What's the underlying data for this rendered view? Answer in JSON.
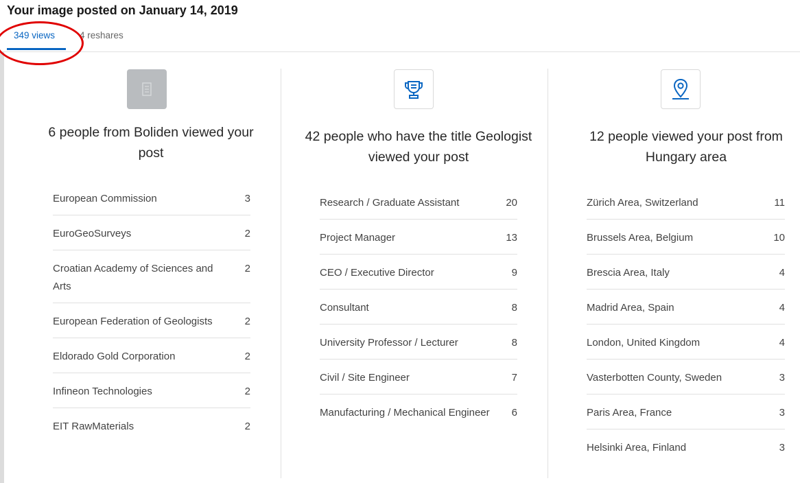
{
  "header": {
    "title": "Your image posted on January 14, 2019"
  },
  "tabs": [
    {
      "label": "349 views",
      "active": true
    },
    {
      "label": "4 reshares",
      "active": false
    }
  ],
  "colors": {
    "accent": "#0a66c2",
    "annotation": "#e00000"
  },
  "columns": [
    {
      "icon": "building-icon",
      "heading": "6 people from Boliden viewed your post",
      "rows": [
        {
          "label": "European Commission",
          "count": "3"
        },
        {
          "label": "EuroGeoSurveys",
          "count": "2"
        },
        {
          "label": "Croatian Academy of Sciences and Arts",
          "count": "2"
        },
        {
          "label": "European Federation of Geologists",
          "count": "2"
        },
        {
          "label": "Eldorado Gold Corporation",
          "count": "2"
        },
        {
          "label": "Infineon Technologies",
          "count": "2"
        },
        {
          "label": "EIT RawMaterials",
          "count": "2"
        }
      ]
    },
    {
      "icon": "trophy-icon",
      "heading": "42 people who have the title Geologist viewed your post",
      "rows": [
        {
          "label": "Research / Graduate Assistant",
          "count": "20"
        },
        {
          "label": "Project Manager",
          "count": "13"
        },
        {
          "label": "CEO / Executive Director",
          "count": "9"
        },
        {
          "label": "Consultant",
          "count": "8"
        },
        {
          "label": "University Professor / Lecturer",
          "count": "8"
        },
        {
          "label": "Civil / Site Engineer",
          "count": "7"
        },
        {
          "label": "Manufacturing / Mechanical Engineer",
          "count": "6"
        }
      ]
    },
    {
      "icon": "location-pin-icon",
      "heading": "12 people viewed your post from Hungary area",
      "rows": [
        {
          "label": "Zürich Area, Switzerland",
          "count": "11"
        },
        {
          "label": "Brussels Area, Belgium",
          "count": "10"
        },
        {
          "label": "Brescia Area, Italy",
          "count": "4"
        },
        {
          "label": "Madrid Area, Spain",
          "count": "4"
        },
        {
          "label": "London, United Kingdom",
          "count": "4"
        },
        {
          "label": "Vasterbotten County, Sweden",
          "count": "3"
        },
        {
          "label": "Paris Area, France",
          "count": "3"
        },
        {
          "label": "Helsinki Area, Finland",
          "count": "3"
        }
      ]
    }
  ]
}
